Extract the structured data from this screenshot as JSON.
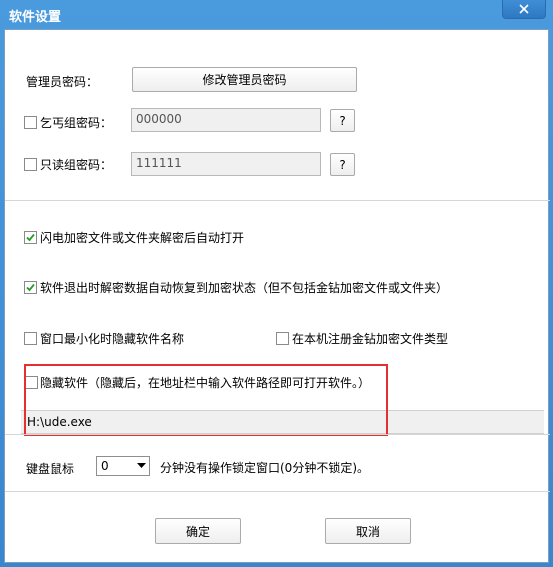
{
  "window": {
    "title": "软件设置"
  },
  "admin": {
    "label": "管理员密码：",
    "button": "修改管理员密码"
  },
  "beggar_group": {
    "label": "乞丐组密码：",
    "value": "000000",
    "help": "?",
    "checked": false
  },
  "readonly_group": {
    "label": "只读组密码：",
    "value": "111111",
    "help": "?",
    "checked": false
  },
  "options": {
    "flash_open": {
      "label": "闪电加密文件或文件夹解密后自动打开",
      "checked": true
    },
    "restore_on_exit": {
      "label": "软件退出时解密数据自动恢复到加密状态（但不包括金钻加密文件或文件夹）",
      "checked": true
    },
    "hide_name_minimized": {
      "label": "窗口最小化时隐藏软件名称",
      "checked": false
    },
    "register_type": {
      "label": "在本机注册金钻加密文件类型",
      "checked": false
    },
    "hide_software": {
      "label": "隐藏软件（隐藏后，在地址栏中输入软件路径即可打开软件。）",
      "checked": false
    }
  },
  "path": {
    "value": "H:\\ude.exe"
  },
  "lock": {
    "label": "键盘鼠标",
    "selected": "0",
    "suffix": "分钟没有操作锁定窗口(0分钟不锁定)。"
  },
  "footer": {
    "ok": "确定",
    "cancel": "取消"
  },
  "colors": {
    "titlebar": "#3f8fd2",
    "highlight": "#e53030",
    "check": "#2a9a2a"
  }
}
